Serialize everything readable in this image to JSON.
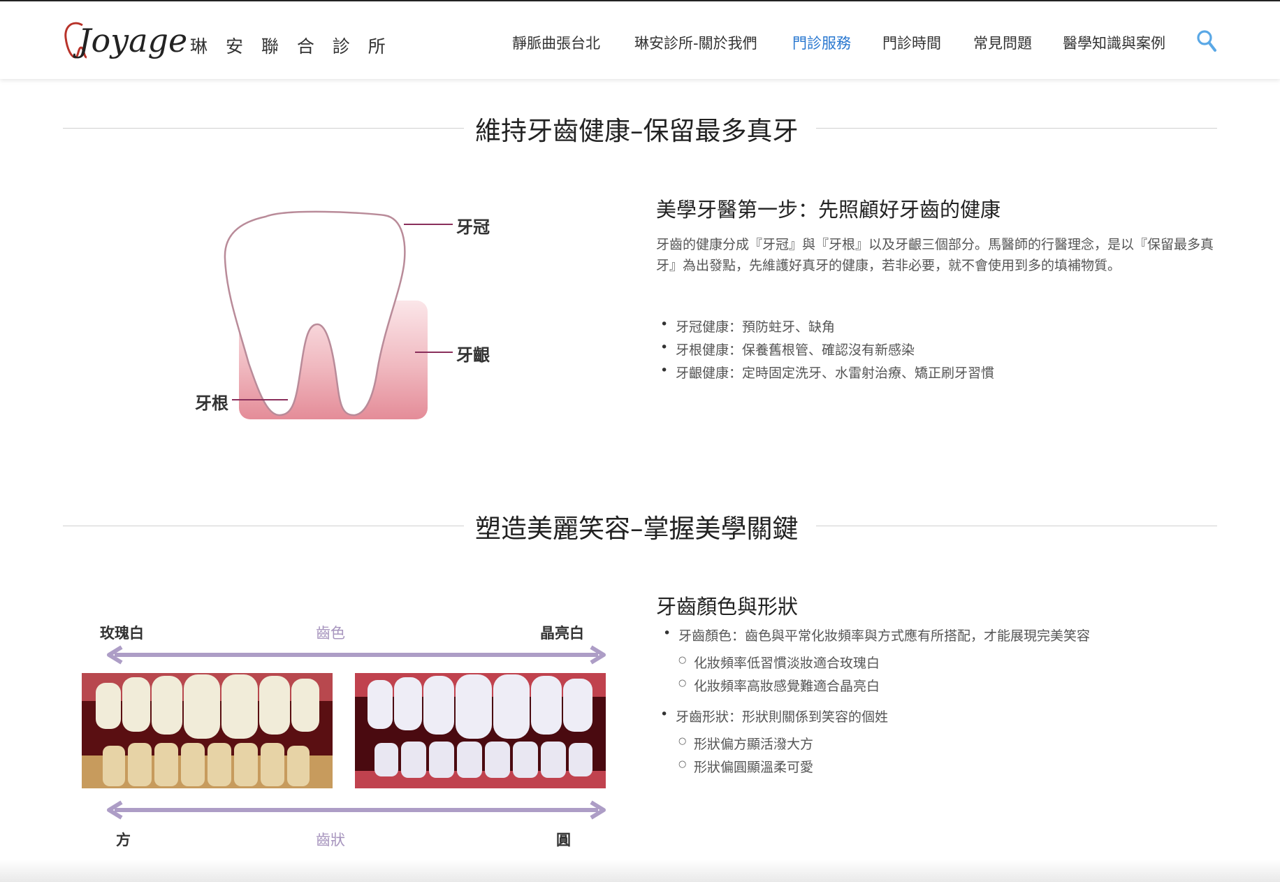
{
  "header": {
    "logo_script": "Joyage",
    "logo_name": "琳 安 聯 合 診 所",
    "nav": [
      {
        "label": "靜脈曲張台北",
        "active": false
      },
      {
        "label": "琳安診所-關於我們",
        "active": false
      },
      {
        "label": "門診服務",
        "active": true
      },
      {
        "label": "門診時間",
        "active": false
      },
      {
        "label": "常見問題",
        "active": false
      },
      {
        "label": "醫學知識與案例",
        "active": false
      }
    ],
    "accent_color": "#2a78d0"
  },
  "section1": {
    "title": "維持牙齒健康–保留最多真牙",
    "diagram_labels": {
      "crown": "牙冠",
      "gum": "牙齦",
      "root": "牙根"
    },
    "heading": "美學牙醫第一步：先照顧好牙齒的健康",
    "paragraph": "牙齒的健康分成『牙冠』與『牙根』以及牙齦三個部分。馬醫師的行醫理念，是以『保留最多真牙』為出發點，先維護好真牙的健康，若非必要，就不會使用到多的填補物質。",
    "bullets": [
      "牙冠健康：預防蛀牙、缺角",
      "牙根健康：保養舊根管、確認沒有新感染",
      "牙齦健康：定時固定洗牙、水雷射治療、矯正刷牙習慣"
    ]
  },
  "section2": {
    "title": "塑造美麗笑容–掌握美學關鍵",
    "compare": {
      "color_left": "玫瑰白",
      "color_axis": "齒色",
      "color_right": "晶亮白",
      "shape_left": "方",
      "shape_axis": "齒狀",
      "shape_right": "圓"
    },
    "heading": "牙齒顏色與形狀",
    "bullet1": "牙齒顏色：齒色與平常化妝頻率與方式應有所搭配，才能展現完美笑容",
    "bullet1_subs": [
      "化妝頻率低習慣淡妝適合玫瑰白",
      "化妝頻率高妝感覺難適合晶亮白"
    ],
    "bullet2": "牙齒形狀：形狀則關係到笑容的個姓",
    "bullet2_subs": [
      "形狀偏方顯活潑大方",
      "形狀偏圓顯溫柔可愛"
    ]
  }
}
